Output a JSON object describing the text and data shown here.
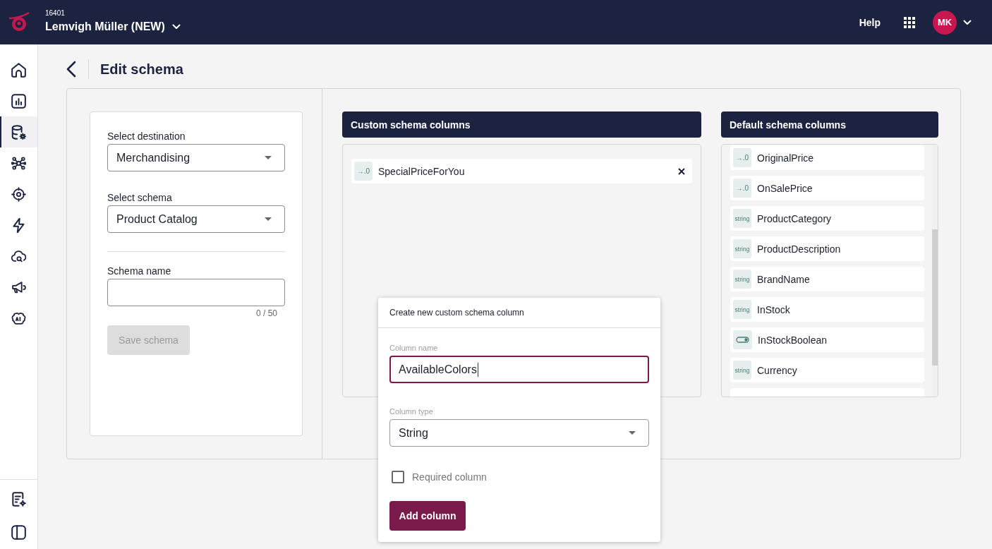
{
  "topbar": {
    "account_id": "16401",
    "account_name": "Lemvigh Müller (NEW)",
    "help": "Help",
    "avatar_initials": "MK"
  },
  "sidebar": {
    "items": [
      {
        "selected": false
      },
      {
        "selected": false
      },
      {
        "selected": true
      },
      {
        "selected": false
      },
      {
        "selected": false
      },
      {
        "selected": false
      },
      {
        "selected": false
      },
      {
        "selected": false
      },
      {
        "selected": false
      }
    ],
    "bottom_items": [
      {
        "selected": false
      },
      {
        "selected": false
      }
    ]
  },
  "page": {
    "title": "Edit schema"
  },
  "form": {
    "destination": {
      "label": "Select destination",
      "value": "Merchandising"
    },
    "schema": {
      "label": "Select schema",
      "value": "Product Catalog"
    },
    "schema_name": {
      "label": "Schema name",
      "counter": "0 / 50"
    },
    "save_button": {
      "label": "Save schema",
      "disabled": true
    }
  },
  "custom_columns": {
    "title": "Custom schema columns",
    "items": [
      {
        "kind": "number",
        "badge": "→.0",
        "name": "SpecialPriceForYou"
      }
    ]
  },
  "default_columns": {
    "title": "Default schema columns",
    "items": [
      {
        "kind": "number",
        "badge": "→.0",
        "name": "OriginalPrice"
      },
      {
        "kind": "number",
        "badge": "→.0",
        "name": "OnSalePrice"
      },
      {
        "kind": "string",
        "badge": "string",
        "name": "ProductCategory"
      },
      {
        "kind": "string",
        "badge": "string",
        "name": "ProductDescription"
      },
      {
        "kind": "string",
        "badge": "string",
        "name": "BrandName"
      },
      {
        "kind": "string",
        "badge": "string",
        "name": "InStock"
      },
      {
        "kind": "boolean",
        "name": "InStockBoolean"
      },
      {
        "kind": "string",
        "badge": "string",
        "name": "Currency"
      },
      {
        "kind": "partial"
      }
    ]
  },
  "dialog": {
    "title": "Create new custom schema column",
    "name_field": {
      "label": "Column name",
      "value": "AvailableColors",
      "focused": true
    },
    "type_field": {
      "label": "Column type",
      "value": "String"
    },
    "required": {
      "label": "Required column",
      "checked": false
    },
    "submit": "Add column"
  }
}
